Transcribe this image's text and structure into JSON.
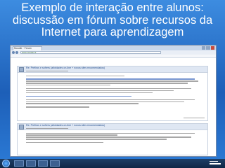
{
  "slide": {
    "title": "Exemplo de interação entre alunos: discussão em fórum sobre recursos da Internet para aprendizagem"
  },
  "browser": {
    "tab_title": "Moodle · Fórum",
    "url": "www.moodle.pt"
  },
  "forum": {
    "post1": {
      "subject": "Re: Prefiros e sofrers (atividades on-line + novos sites recomendados)"
    },
    "post2": {
      "subject": "Re: Prefiros e sofrers (atividades on-line + novos sites recomendados)"
    }
  },
  "taskbar": {}
}
